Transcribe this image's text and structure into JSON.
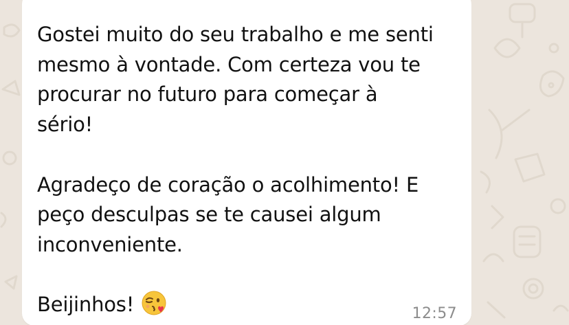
{
  "chat": {
    "message": {
      "line1": "Gostei muito do seu trabalho e me senti",
      "line2": "mesmo à vontade. Com certeza vou te",
      "line3": "procurar no futuro para começar à",
      "line4": "sério!",
      "line5": "Agradeço de coração o acolhimento! E",
      "line6": "peço desculpas se te causei algum",
      "line7": "inconveniente.",
      "line8": "Beijinhos!"
    },
    "emoji": "kissing-face-with-heart-icon",
    "timestamp": "12:57"
  },
  "colors": {
    "wallpaper": "#ece5dd",
    "bubble": "#ffffff",
    "text": "#111111",
    "timestamp": "#8c8c8c"
  }
}
